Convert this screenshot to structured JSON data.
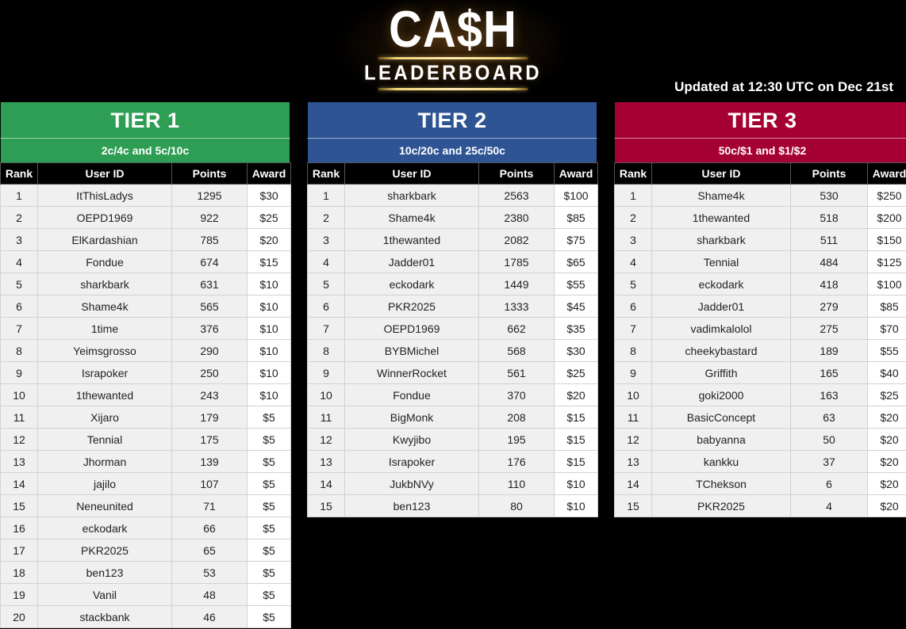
{
  "header": {
    "logo_line1": "CA$H",
    "logo_line2": "LEADERBOARD",
    "updated": "Updated at 12:30 UTC on Dec 21st",
    "background": "#000000",
    "accent_gold": "#f3d479"
  },
  "columns": {
    "rank": "Rank",
    "user": "User ID",
    "points": "Points",
    "award": "Award"
  },
  "tiers": [
    {
      "title": "TIER 1",
      "subtitle": "2c/4c and 5c/10c",
      "color": "#2e9e54",
      "rows": [
        {
          "rank": "1",
          "user": "ItThisLadys",
          "points": "1295",
          "award": "$30"
        },
        {
          "rank": "2",
          "user": "OEPD1969",
          "points": "922",
          "award": "$25"
        },
        {
          "rank": "3",
          "user": "ElKardashian",
          "points": "785",
          "award": "$20"
        },
        {
          "rank": "4",
          "user": "Fondue",
          "points": "674",
          "award": "$15"
        },
        {
          "rank": "5",
          "user": "sharkbark",
          "points": "631",
          "award": "$10"
        },
        {
          "rank": "6",
          "user": "Shame4k",
          "points": "565",
          "award": "$10"
        },
        {
          "rank": "7",
          "user": "1time",
          "points": "376",
          "award": "$10"
        },
        {
          "rank": "8",
          "user": "Yeimsgrosso",
          "points": "290",
          "award": "$10"
        },
        {
          "rank": "9",
          "user": "Israpoker",
          "points": "250",
          "award": "$10"
        },
        {
          "rank": "10",
          "user": "1thewanted",
          "points": "243",
          "award": "$10"
        },
        {
          "rank": "11",
          "user": "Xijaro",
          "points": "179",
          "award": "$5"
        },
        {
          "rank": "12",
          "user": "Tennial",
          "points": "175",
          "award": "$5"
        },
        {
          "rank": "13",
          "user": "Jhorman",
          "points": "139",
          "award": "$5"
        },
        {
          "rank": "14",
          "user": "jajilo",
          "points": "107",
          "award": "$5"
        },
        {
          "rank": "15",
          "user": "Neneunited",
          "points": "71",
          "award": "$5"
        },
        {
          "rank": "16",
          "user": "eckodark",
          "points": "66",
          "award": "$5"
        },
        {
          "rank": "17",
          "user": "PKR2025",
          "points": "65",
          "award": "$5"
        },
        {
          "rank": "18",
          "user": "ben123",
          "points": "53",
          "award": "$5"
        },
        {
          "rank": "19",
          "user": "Vanil",
          "points": "48",
          "award": "$5"
        },
        {
          "rank": "20",
          "user": "stackbank",
          "points": "46",
          "award": "$5"
        }
      ]
    },
    {
      "title": "TIER 2",
      "subtitle": "10c/20c and 25c/50c",
      "color": "#2e5494",
      "rows": [
        {
          "rank": "1",
          "user": "sharkbark",
          "points": "2563",
          "award": "$100"
        },
        {
          "rank": "2",
          "user": "Shame4k",
          "points": "2380",
          "award": "$85"
        },
        {
          "rank": "3",
          "user": "1thewanted",
          "points": "2082",
          "award": "$75"
        },
        {
          "rank": "4",
          "user": "Jadder01",
          "points": "1785",
          "award": "$65"
        },
        {
          "rank": "5",
          "user": "eckodark",
          "points": "1449",
          "award": "$55"
        },
        {
          "rank": "6",
          "user": "PKR2025",
          "points": "1333",
          "award": "$45"
        },
        {
          "rank": "7",
          "user": "OEPD1969",
          "points": "662",
          "award": "$35"
        },
        {
          "rank": "8",
          "user": "BYBMichel",
          "points": "568",
          "award": "$30"
        },
        {
          "rank": "9",
          "user": "WinnerRocket",
          "points": "561",
          "award": "$25"
        },
        {
          "rank": "10",
          "user": "Fondue",
          "points": "370",
          "award": "$20"
        },
        {
          "rank": "11",
          "user": "BigMonk",
          "points": "208",
          "award": "$15"
        },
        {
          "rank": "12",
          "user": "Kwyjibo",
          "points": "195",
          "award": "$15"
        },
        {
          "rank": "13",
          "user": "Israpoker",
          "points": "176",
          "award": "$15"
        },
        {
          "rank": "14",
          "user": "JukbNVy",
          "points": "110",
          "award": "$10"
        },
        {
          "rank": "15",
          "user": "ben123",
          "points": "80",
          "award": "$10"
        }
      ]
    },
    {
      "title": "TIER 3",
      "subtitle": "50c/$1 and $1/$2",
      "color": "#a50034",
      "rows": [
        {
          "rank": "1",
          "user": "Shame4k",
          "points": "530",
          "award": "$250"
        },
        {
          "rank": "2",
          "user": "1thewanted",
          "points": "518",
          "award": "$200"
        },
        {
          "rank": "3",
          "user": "sharkbark",
          "points": "511",
          "award": "$150"
        },
        {
          "rank": "4",
          "user": "Tennial",
          "points": "484",
          "award": "$125"
        },
        {
          "rank": "5",
          "user": "eckodark",
          "points": "418",
          "award": "$100"
        },
        {
          "rank": "6",
          "user": "Jadder01",
          "points": "279",
          "award": "$85"
        },
        {
          "rank": "7",
          "user": "vadimkalolol",
          "points": "275",
          "award": "$70"
        },
        {
          "rank": "8",
          "user": "cheekybastard",
          "points": "189",
          "award": "$55"
        },
        {
          "rank": "9",
          "user": "Griffith",
          "points": "165",
          "award": "$40"
        },
        {
          "rank": "10",
          "user": "goki2000",
          "points": "163",
          "award": "$25"
        },
        {
          "rank": "11",
          "user": "BasicConcept",
          "points": "63",
          "award": "$20"
        },
        {
          "rank": "12",
          "user": "babyanna",
          "points": "50",
          "award": "$20"
        },
        {
          "rank": "13",
          "user": "kankku",
          "points": "37",
          "award": "$20"
        },
        {
          "rank": "14",
          "user": "TChekson",
          "points": "6",
          "award": "$20"
        },
        {
          "rank": "15",
          "user": "PKR2025",
          "points": "4",
          "award": "$20"
        }
      ]
    }
  ]
}
